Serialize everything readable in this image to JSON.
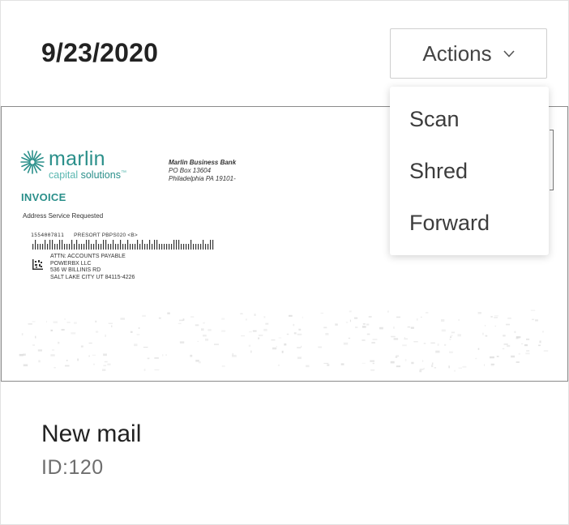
{
  "card": {
    "date": "9/23/2020",
    "title": "New mail",
    "id_text": "ID:120"
  },
  "actions": {
    "label": "Actions",
    "icon": "chevron-down-icon",
    "menu_items": [
      "Scan",
      "Shred",
      "Forward"
    ]
  },
  "envelope": {
    "logo_name": "marlin",
    "logo_sub_1": "capital ",
    "logo_sub_2": "solutions",
    "logo_tm": "™",
    "bank_line1": "Marlin Business Bank",
    "bank_line2": "PO Box 13604",
    "bank_line3": "Philadelphia PA 19101-",
    "invoice": "INVOICE",
    "address_service": "Address Service Requested",
    "piece_number": "1554007811",
    "presort": "PRESORT PBPS020 <B>",
    "recipient_lines": [
      "ATTN: ACCOUNTS PAYABLE",
      "POWERBX LLC",
      "536 W BILLINIS RD",
      "SALT LAKE CITY UT 84115-4226"
    ]
  },
  "colors": {
    "brand_teal": "#2a8f8a",
    "brand_teal_light": "#5ab7b0",
    "text_dark": "#222222",
    "text_muted": "#6e6e6e"
  }
}
